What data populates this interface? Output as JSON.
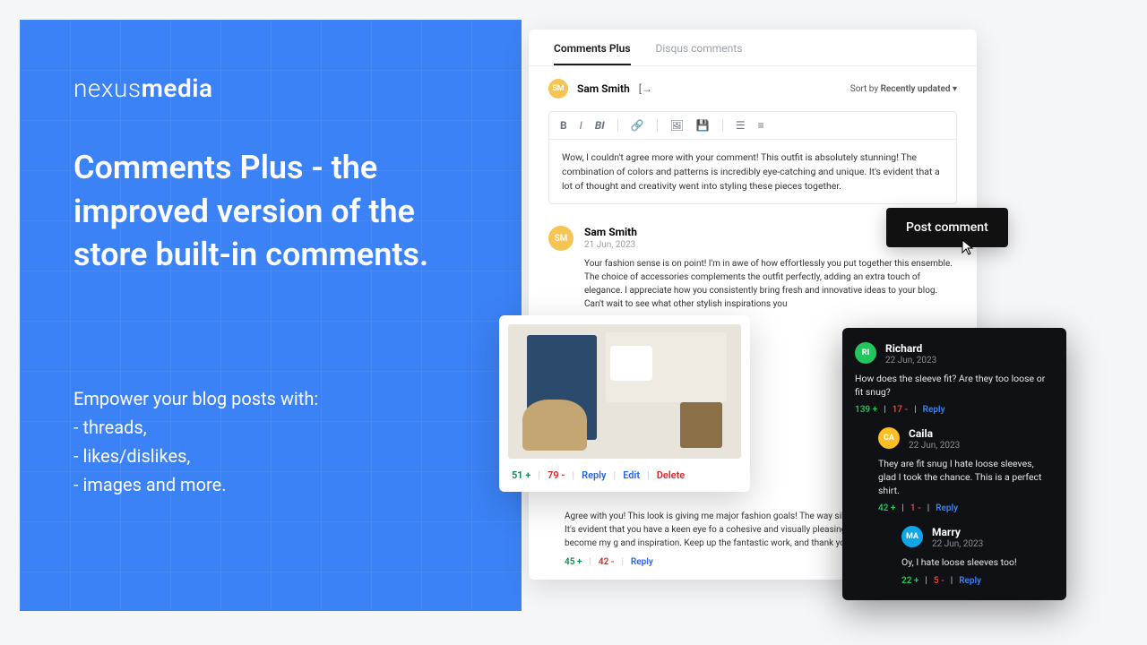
{
  "brand": {
    "prefix": "nexus",
    "suffix": "media"
  },
  "headline": "Comments Plus - the improved version of the store built-in comments.",
  "sub_intro": "Empower your blog posts with:",
  "sub_items": [
    "- threads,",
    "- likes/dislikes,",
    "- images and more."
  ],
  "tabs": {
    "active": "Comments Plus",
    "other": "Disqus comments"
  },
  "user": {
    "initials": "SM",
    "name": "Sam Smith",
    "logout_icon": "[→"
  },
  "sort": {
    "label": "Sort by",
    "value": "Recently updated",
    "caret": "▾"
  },
  "toolbar": {
    "bold": "B",
    "italic": "I",
    "bolditalic": "BI",
    "link": "🔗",
    "image": "🖼",
    "save": "💾",
    "ul": "☰",
    "ol": "≡"
  },
  "editor_text": "Wow, I couldn't agree more with your comment! This outfit is absolutely stunning! The combination of colors and patterns is incredibly eye-catching and unique. It's evident that a lot of thought and creativity went into styling these pieces together.",
  "post_button": "Post comment",
  "comment1": {
    "initials": "SM",
    "name": "Sam Smith",
    "date": "21 Jun, 2023",
    "text": "Your fashion sense is on point! I'm in awe of how effortlessly you put together this ensemble. The choice of accessories complements the outfit perfectly, adding an extra touch of elegance. I appreciate how you consistently bring fresh and innovative ideas to your blog. Can't wait to see what other stylish inspirations you"
  },
  "image_card": {
    "up": "51 +",
    "down": "79 -",
    "reply": "Reply",
    "edit": "Edit",
    "delete": "Delete"
  },
  "comment2": {
    "text": "Agree with you! This look is giving me major fashion goals! The way silhouettes is truly inspiring. It's evident that you have a keen eye fo a cohesive and visually pleasing outfit. Your blog has become my g and inspiration. Keep up the fantastic work, and thank you for shari",
    "up": "45 +",
    "down": "42 -",
    "reply": "Reply"
  },
  "dark": {
    "c1": {
      "initials": "RI",
      "name": "Richard",
      "date": "22 Jun, 2023",
      "text": "How does the sleeve fit? Are they too loose or fit snug?",
      "up": "139 +",
      "down": "17 -",
      "reply": "Reply"
    },
    "c2": {
      "initials": "CA",
      "name": "Caila",
      "date": "22 Jun, 2023",
      "text": "They are fit snug I hate loose sleeves, glad I took the chance. This is a perfect shirt.",
      "up": "42 +",
      "down": "1 -",
      "reply": "Reply"
    },
    "c3": {
      "initials": "MA",
      "name": "Marry",
      "date": "22 Jun, 2023",
      "text": "Oy, I hate loose sleeves too!",
      "up": "22 +",
      "down": "5 -",
      "reply": "Reply"
    }
  }
}
